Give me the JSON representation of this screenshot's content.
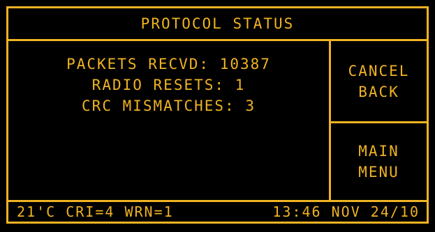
{
  "header": {
    "title": "PROTOCOL STATUS"
  },
  "stats": [
    {
      "label": "PACKETS RECVD: 10387"
    },
    {
      "label": "RADIO RESETS: 1"
    },
    {
      "label": "CRC MISMATCHES: 3"
    }
  ],
  "buttons": {
    "back": {
      "line1": "CANCEL",
      "line2": "BACK"
    },
    "menu": {
      "line1": "MAIN",
      "line2": "MENU"
    }
  },
  "status_bar": {
    "left": "21'C CRI=4 WRN=1",
    "right": "13:46 NOV 24/10"
  },
  "colors": {
    "foreground": "#f0b323",
    "background": "#000000"
  }
}
